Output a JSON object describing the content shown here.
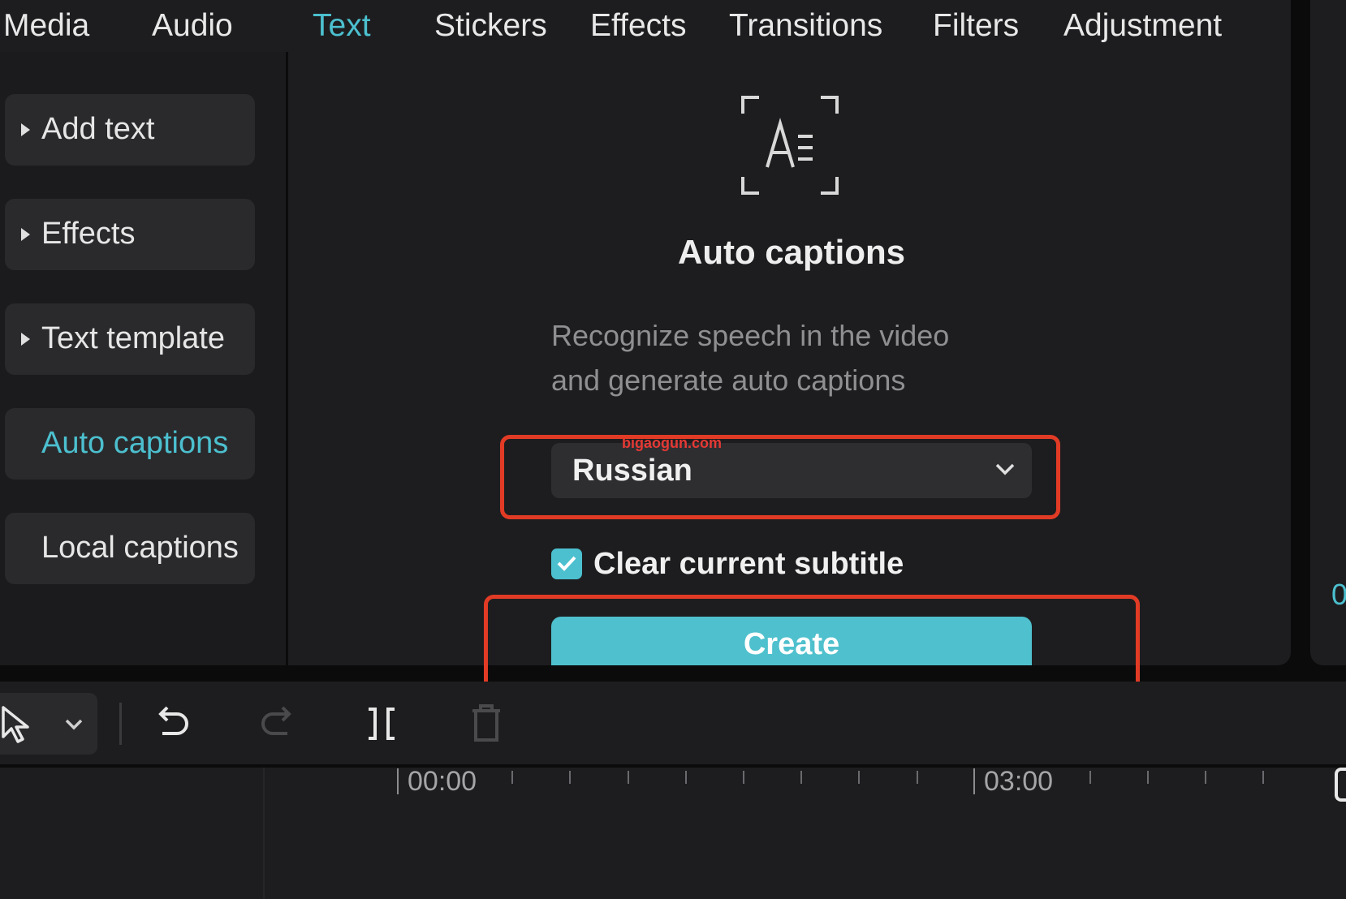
{
  "topbar": {
    "tabs": [
      {
        "label": "Media"
      },
      {
        "label": "Audio"
      },
      {
        "label": "Text",
        "active": true
      },
      {
        "label": "Stickers"
      },
      {
        "label": "Effects"
      },
      {
        "label": "Transitions"
      },
      {
        "label": "Filters"
      },
      {
        "label": "Adjustment"
      }
    ]
  },
  "sidebar": {
    "items": [
      {
        "label": "Add text"
      },
      {
        "label": "Effects"
      },
      {
        "label": "Text template"
      },
      {
        "label": "Auto captions",
        "active": true
      },
      {
        "label": "Local captions"
      }
    ]
  },
  "auto_captions": {
    "icon": "auto-captions-icon",
    "title": "Auto captions",
    "description_line1": "Recognize speech in the video",
    "description_line2": "and generate auto captions",
    "language_selected": "Russian",
    "clear_subtitle_label": "Clear current subtitle",
    "clear_subtitle_checked": true,
    "create_label": "Create"
  },
  "watermark": "bigaogun.com",
  "right_panel": {
    "partial_text": "0"
  },
  "timeline": {
    "time_labels": [
      "00:00",
      "03:00"
    ]
  },
  "colors": {
    "accent": "#4cc0cf",
    "highlight": "#e23b25",
    "panel": "#1d1d1f"
  }
}
